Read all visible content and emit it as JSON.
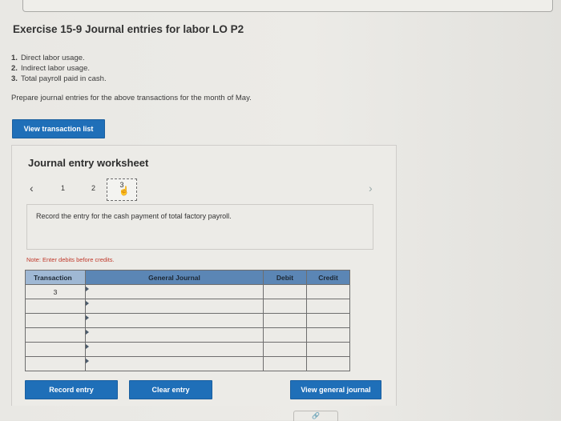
{
  "header": {
    "title": "Exercise 15-9 Journal entries for labor LO P2"
  },
  "transactions": [
    {
      "num": "1.",
      "text": "Direct labor usage."
    },
    {
      "num": "2.",
      "text": "Indirect labor usage."
    },
    {
      "num": "3.",
      "text": "Total payroll paid in cash."
    }
  ],
  "prompt": "Prepare journal entries for the above transactions for the month of May.",
  "buttons": {
    "view_transaction_list": "View transaction list",
    "record_entry": "Record entry",
    "clear_entry": "Clear entry",
    "view_general_journal": "View general journal"
  },
  "worksheet": {
    "title": "Journal entry worksheet",
    "pages": [
      "1",
      "2",
      "3"
    ],
    "current_page": "3",
    "instruction": "Record the entry for the cash payment of total factory payroll.",
    "note": "Note: Enter debits before credits."
  },
  "table": {
    "headers": {
      "transaction": "Transaction",
      "general_journal": "General Journal",
      "debit": "Debit",
      "credit": "Credit"
    },
    "rows": [
      {
        "transaction": "3",
        "account": "",
        "debit": "",
        "credit": ""
      },
      {
        "transaction": "",
        "account": "",
        "debit": "",
        "credit": ""
      },
      {
        "transaction": "",
        "account": "",
        "debit": "",
        "credit": ""
      },
      {
        "transaction": "",
        "account": "",
        "debit": "",
        "credit": ""
      },
      {
        "transaction": "",
        "account": "",
        "debit": "",
        "credit": ""
      },
      {
        "transaction": "",
        "account": "",
        "debit": "",
        "credit": ""
      }
    ]
  },
  "colors": {
    "accent": "#1f6fb8",
    "header_bg": "#5b86b5",
    "note": "#c0392b"
  },
  "icons": {
    "prev": "chevron-left-icon",
    "next": "chevron-right-icon",
    "cursor": "hand-cursor-icon"
  }
}
